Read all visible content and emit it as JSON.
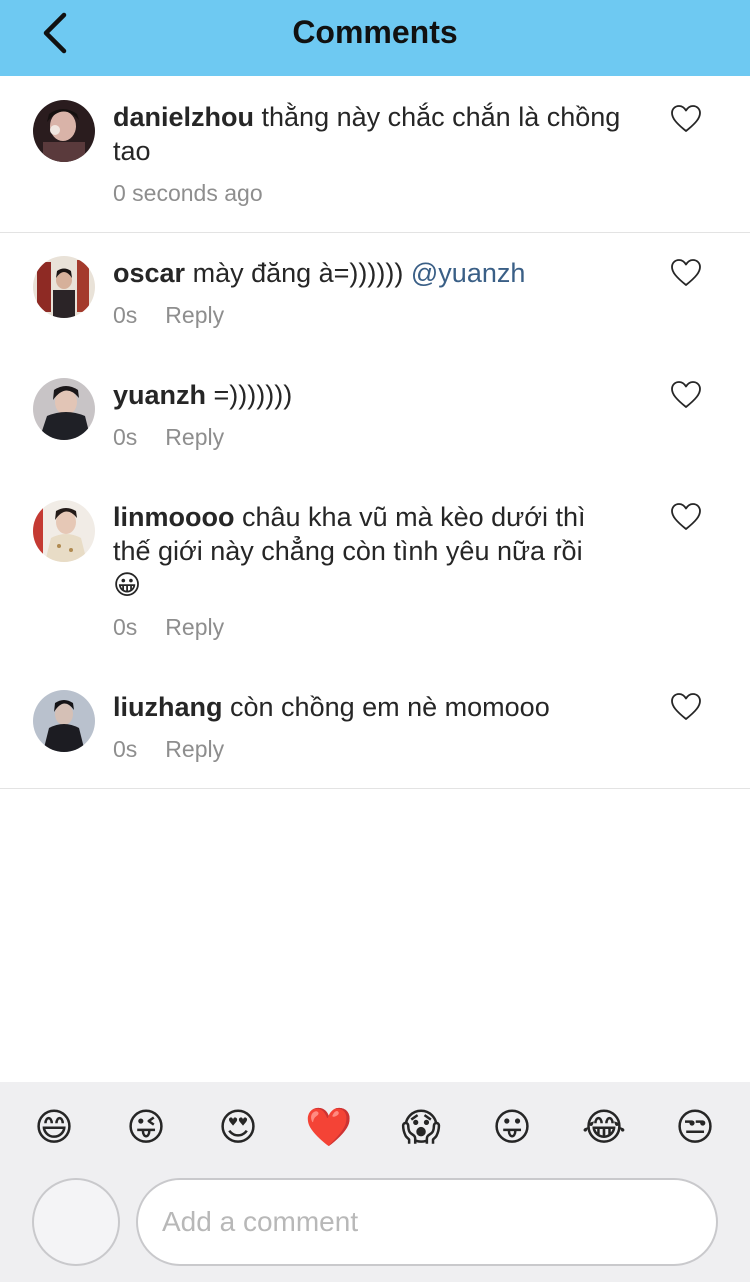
{
  "header": {
    "title": "Comments",
    "back_icon": "chevron-left-icon"
  },
  "caption": {
    "username": "danielzhou",
    "text": "thằng này chắc chắn là chồng tao",
    "time": "0 seconds ago"
  },
  "comments": [
    {
      "username": "oscar",
      "text": "mày đăng à=)))))) ",
      "mention": "@yuanzh",
      "time": "0s",
      "reply_label": "Reply"
    },
    {
      "username": "yuanzh",
      "text": "=)))))))",
      "mention": "",
      "time": "0s",
      "reply_label": "Reply"
    },
    {
      "username": "linmoooo",
      "text": "châu kha vũ mà kèo dưới thì thế giới này chẳng còn tình yêu nữa rồi 😀",
      "mention": "",
      "time": "0s",
      "reply_label": "Reply"
    },
    {
      "username": "liuzhang",
      "text": "còn chồng em nè momooo",
      "mention": "",
      "time": "0s",
      "reply_label": "Reply"
    }
  ],
  "emoji_bar": [
    "😄",
    "😜",
    "😍",
    "❤️",
    "😱",
    "😛",
    "😂",
    "😒"
  ],
  "composer": {
    "placeholder": "Add a comment"
  },
  "colors": {
    "header_bg": "#6ec9f2",
    "mention": "#3a5f86",
    "meta": "#8e8e8e",
    "bottom_bar": "#efeff1"
  }
}
